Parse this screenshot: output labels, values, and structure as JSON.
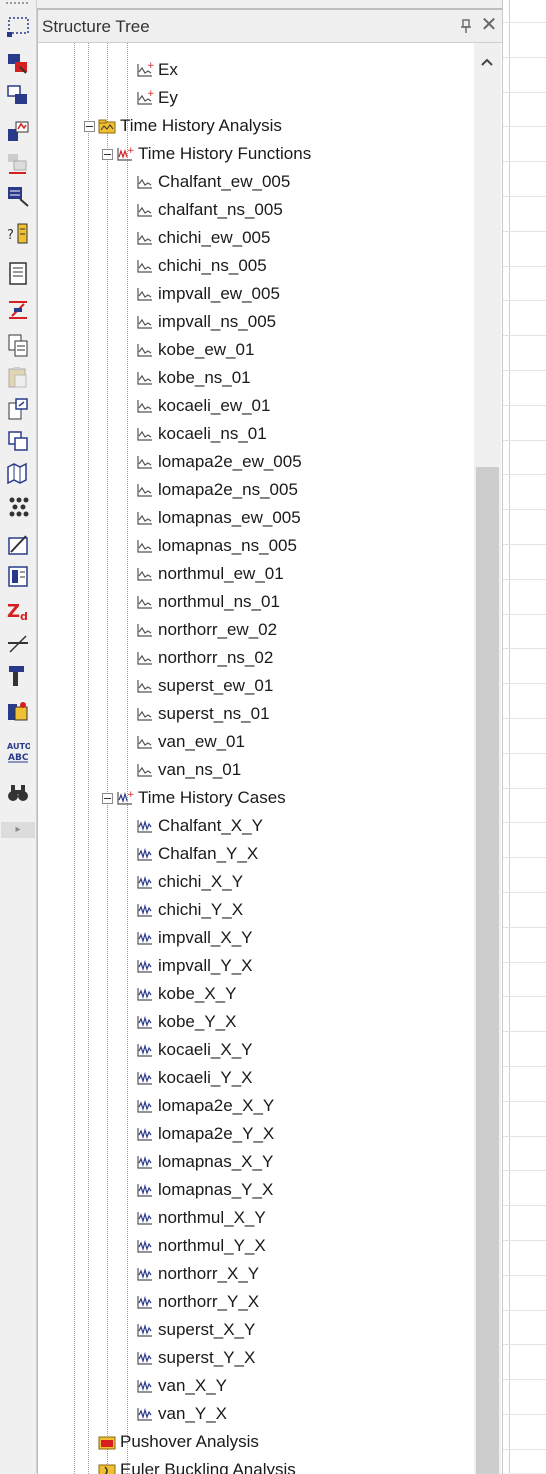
{
  "panel": {
    "title": "Structure Tree",
    "pin_icon": "pin-icon",
    "close_icon": "close-icon"
  },
  "toolbar": {
    "icons": [
      "select-window-icon",
      "load-icon-1",
      "load-icon-2",
      "chart-icon",
      "stack-icon",
      "settings-icon",
      "numbers-icon",
      "document-icon",
      "beam-icon",
      "copy-icon",
      "paste-icon",
      "export-icon",
      "duplicate-icon",
      "map-icon",
      "nodes-icon",
      "hatch-icon",
      "report-icon",
      "zd-icon",
      "line-icon",
      "tool-icon",
      "color-icon",
      "auto-abc-icon",
      "binoculars-icon"
    ]
  },
  "tree": {
    "items": [
      {
        "label": "Ex",
        "level": 3,
        "type": "graph-red"
      },
      {
        "label": "Ey",
        "level": 3,
        "type": "graph-red"
      },
      {
        "label": "Time History Analysis",
        "level": 1,
        "type": "folder",
        "expander": true
      },
      {
        "label": "Time History Functions",
        "level": 2,
        "type": "function-group",
        "expander": true
      },
      {
        "label": "Chalfant_ew_005",
        "level": 3,
        "type": "graph"
      },
      {
        "label": "chalfant_ns_005",
        "level": 3,
        "type": "graph"
      },
      {
        "label": "chichi_ew_005",
        "level": 3,
        "type": "graph"
      },
      {
        "label": "chichi_ns_005",
        "level": 3,
        "type": "graph"
      },
      {
        "label": "impvall_ew_005",
        "level": 3,
        "type": "graph"
      },
      {
        "label": "impvall_ns_005",
        "level": 3,
        "type": "graph"
      },
      {
        "label": "kobe_ew_01",
        "level": 3,
        "type": "graph"
      },
      {
        "label": "kobe_ns_01",
        "level": 3,
        "type": "graph"
      },
      {
        "label": "kocaeli_ew_01",
        "level": 3,
        "type": "graph"
      },
      {
        "label": "kocaeli_ns_01",
        "level": 3,
        "type": "graph"
      },
      {
        "label": "lomapa2e_ew_005",
        "level": 3,
        "type": "graph"
      },
      {
        "label": "lomapa2e_ns_005",
        "level": 3,
        "type": "graph"
      },
      {
        "label": "lomapnas_ew_005",
        "level": 3,
        "type": "graph"
      },
      {
        "label": "lomapnas_ns_005",
        "level": 3,
        "type": "graph"
      },
      {
        "label": "northmul_ew_01",
        "level": 3,
        "type": "graph"
      },
      {
        "label": "northmul_ns_01",
        "level": 3,
        "type": "graph"
      },
      {
        "label": "northorr_ew_02",
        "level": 3,
        "type": "graph"
      },
      {
        "label": "northorr_ns_02",
        "level": 3,
        "type": "graph"
      },
      {
        "label": "superst_ew_01",
        "level": 3,
        "type": "graph"
      },
      {
        "label": "superst_ns_01",
        "level": 3,
        "type": "graph"
      },
      {
        "label": "van_ew_01",
        "level": 3,
        "type": "graph"
      },
      {
        "label": "van_ns_01",
        "level": 3,
        "type": "graph"
      },
      {
        "label": "Time History Cases",
        "level": 2,
        "type": "case-group",
        "expander": true
      },
      {
        "label": "Chalfant_X_Y",
        "level": 3,
        "type": "wave"
      },
      {
        "label": "Chalfan_Y_X",
        "level": 3,
        "type": "wave"
      },
      {
        "label": "chichi_X_Y",
        "level": 3,
        "type": "wave"
      },
      {
        "label": "chichi_Y_X",
        "level": 3,
        "type": "wave"
      },
      {
        "label": "impvall_X_Y",
        "level": 3,
        "type": "wave"
      },
      {
        "label": "impvall_Y_X",
        "level": 3,
        "type": "wave"
      },
      {
        "label": "kobe_X_Y",
        "level": 3,
        "type": "wave"
      },
      {
        "label": "kobe_Y_X",
        "level": 3,
        "type": "wave"
      },
      {
        "label": "kocaeli_X_Y",
        "level": 3,
        "type": "wave"
      },
      {
        "label": "kocaeli_Y_X",
        "level": 3,
        "type": "wave"
      },
      {
        "label": "lomapa2e_X_Y",
        "level": 3,
        "type": "wave"
      },
      {
        "label": "lomapa2e_Y_X",
        "level": 3,
        "type": "wave"
      },
      {
        "label": "lomapnas_X_Y",
        "level": 3,
        "type": "wave"
      },
      {
        "label": "lomapnas_Y_X",
        "level": 3,
        "type": "wave"
      },
      {
        "label": "northmul_X_Y",
        "level": 3,
        "type": "wave"
      },
      {
        "label": "northmul_Y_X",
        "level": 3,
        "type": "wave"
      },
      {
        "label": "northorr_X_Y",
        "level": 3,
        "type": "wave"
      },
      {
        "label": "northorr_Y_X",
        "level": 3,
        "type": "wave"
      },
      {
        "label": "superst_X_Y",
        "level": 3,
        "type": "wave"
      },
      {
        "label": "superst_Y_X",
        "level": 3,
        "type": "wave"
      },
      {
        "label": "van_X_Y",
        "level": 3,
        "type": "wave"
      },
      {
        "label": "van_Y_X",
        "level": 3,
        "type": "wave"
      },
      {
        "label": "Pushover Analysis",
        "level": 1,
        "type": "pushover"
      },
      {
        "label": "Euler Buckling Analysis",
        "level": 1,
        "type": "buckling"
      }
    ]
  },
  "colors": {
    "panel_bg": "#ffffff",
    "header_bg": "#efefef",
    "scroll_thumb": "#cdcdcd",
    "icon_red": "#d62020",
    "icon_gray": "#555555",
    "folder_yellow": "#f0c030"
  }
}
